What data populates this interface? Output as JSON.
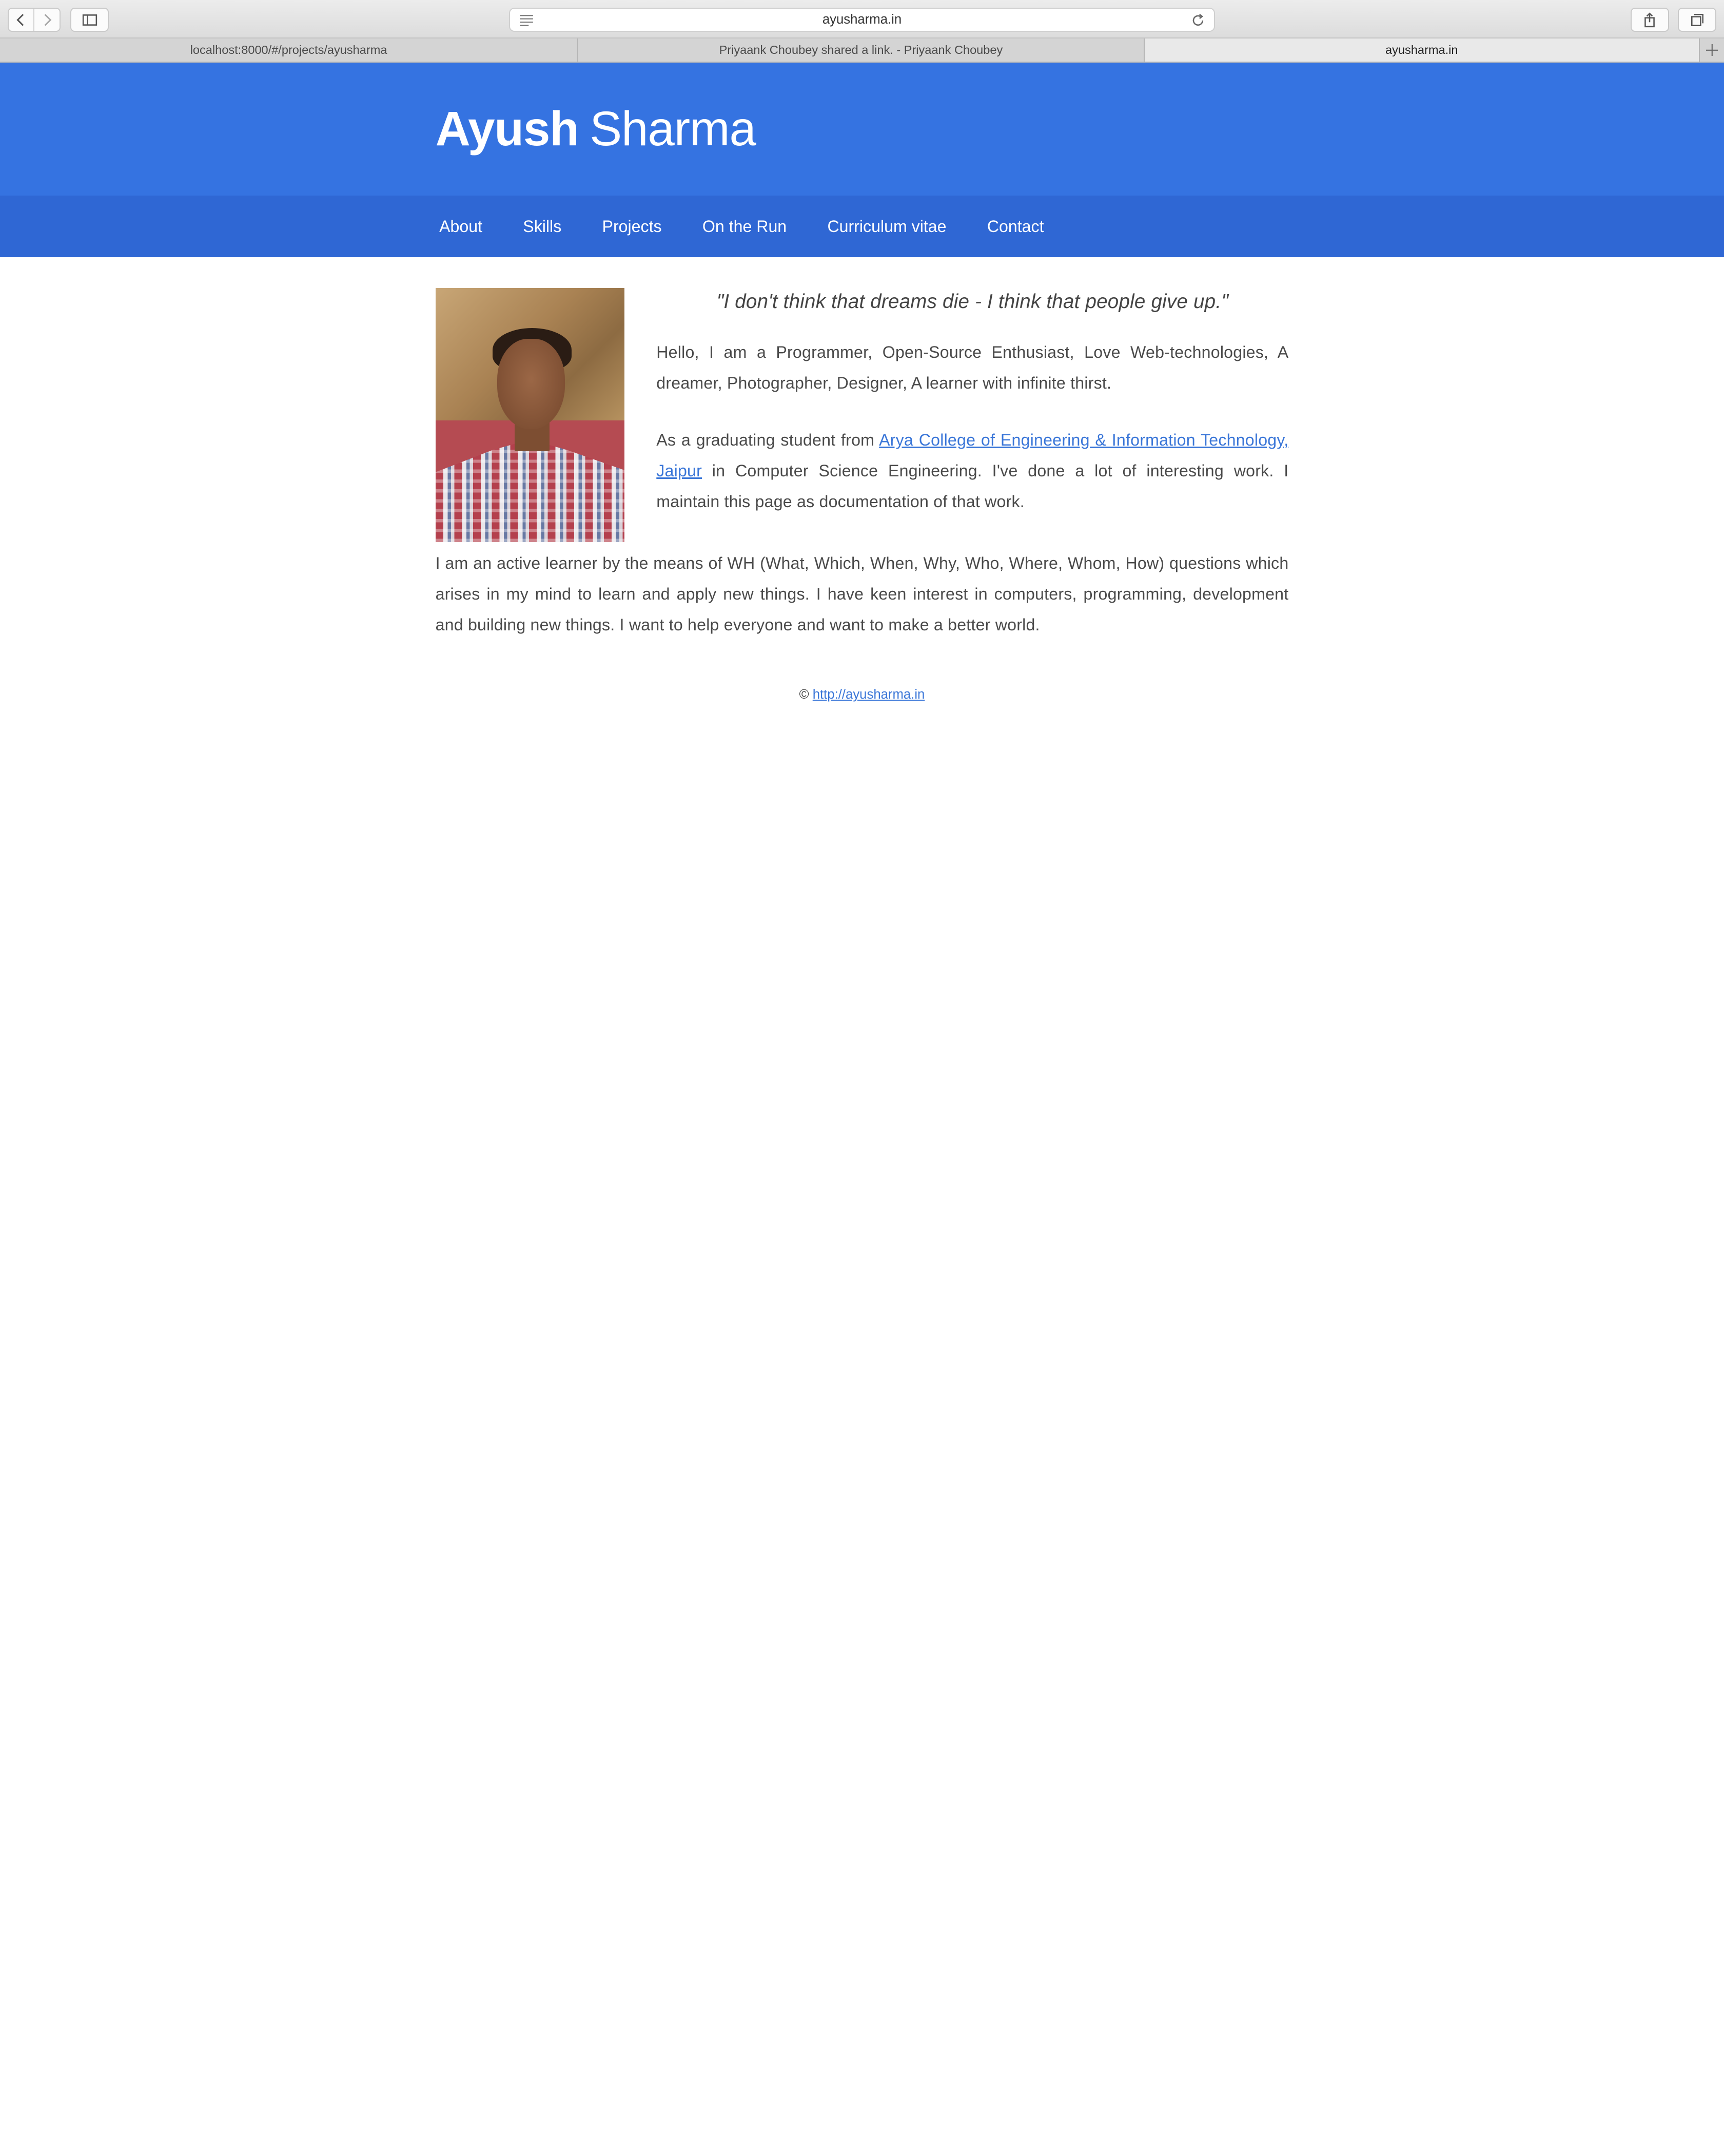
{
  "browser": {
    "url": "ayusharma.in",
    "tabs": [
      {
        "label": "localhost:8000/#/projects/ayusharma",
        "active": false
      },
      {
        "label": "Priyaank Choubey shared a link. - Priyaank Choubey",
        "active": false
      },
      {
        "label": "ayusharma.in",
        "active": true
      }
    ]
  },
  "site": {
    "title_first": "Ayush",
    "title_last": "Sharma",
    "accent_color": "#3573e1",
    "nav_color": "#2f67d4",
    "link_color": "#3a76d8"
  },
  "nav": {
    "items": [
      "About",
      "Skills",
      "Projects",
      "On the Run",
      "Curriculum vitae",
      "Contact"
    ]
  },
  "content": {
    "quote": "\"I don't think that dreams die - I think that people give up.\"",
    "para1": "Hello, I am a Programmer, Open-Source Enthusiast, Love Web-technologies, A dreamer, Photographer, Designer, A learner with infinite thirst.",
    "para2_before": "As a graduating student from ",
    "para2_link": "Arya College of Engineering & Information Technology, Jaipur",
    "para2_after": " in Computer Science Engineering. I've done a lot of interesting work. I maintain this page as documentation of that work.",
    "para3": "I am an active learner by the means of WH (What, Which, When, Why, Who, Where, Whom, How) questions which arises in my mind to learn and apply new things. I have keen interest in computers, programming, development and building new things. I want to help everyone and want to make a better world."
  },
  "footer": {
    "copyright": "©",
    "link": "http://ayusharma.in"
  }
}
